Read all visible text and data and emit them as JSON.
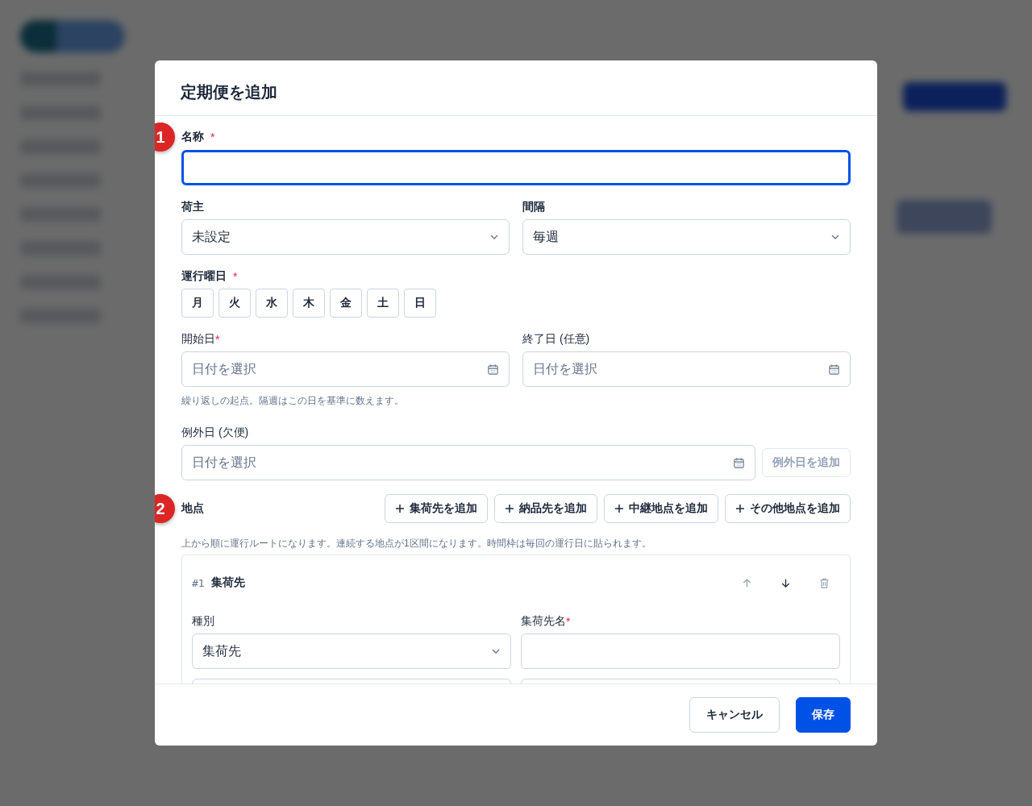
{
  "dialog": {
    "title": "定期便を追加",
    "name_field": {
      "marker": "1",
      "label": "名称",
      "required_mark": "*",
      "focused": true
    },
    "shipper": {
      "label": "荷主",
      "value": "未設定"
    },
    "interval": {
      "label": "間隔",
      "value": "毎週"
    },
    "weekdays": {
      "label": "運行曜日",
      "required_mark": "*",
      "days": [
        {
          "label": "月",
          "selected": false
        },
        {
          "label": "火",
          "selected": false
        },
        {
          "label": "水",
          "selected": false
        },
        {
          "label": "木",
          "selected": false
        },
        {
          "label": "金",
          "selected": false
        },
        {
          "label": "土",
          "selected": false
        },
        {
          "label": "日",
          "selected": false
        }
      ]
    },
    "start_date": {
      "label": "開始日",
      "required_mark": "*",
      "placeholder": "日付を選択",
      "hint": "繰り返しの起点。隔週はこの日を基準に数えます。"
    },
    "end_date": {
      "label": "終了日 (任意)",
      "placeholder": "日付を選択"
    },
    "exceptions": {
      "label": "例外日 (欠便)",
      "placeholder": "日付を選択",
      "add_button": {
        "label": "例外日を追加",
        "disabled": true
      }
    },
    "stops": {
      "marker": "2",
      "label": "地点",
      "add_buttons": [
        "集荷先を追加",
        "納品先を追加",
        "中継地点を追加",
        "その他地点を追加"
      ],
      "hint": "上から順に運行ルートになります。連続する地点が1区間になります。時間枠は毎回の運行日に貼られます。",
      "items": [
        {
          "number": "#1",
          "title": "集荷先",
          "move_up_disabled": true,
          "move_down_disabled": false,
          "delete_disabled": true,
          "type_label": "種別",
          "type_value": "集荷先",
          "name_label": "集荷先名",
          "name_required_mark": "*"
        }
      ]
    }
  },
  "footer": {
    "cancel": "キャンセル",
    "save": "保存"
  }
}
